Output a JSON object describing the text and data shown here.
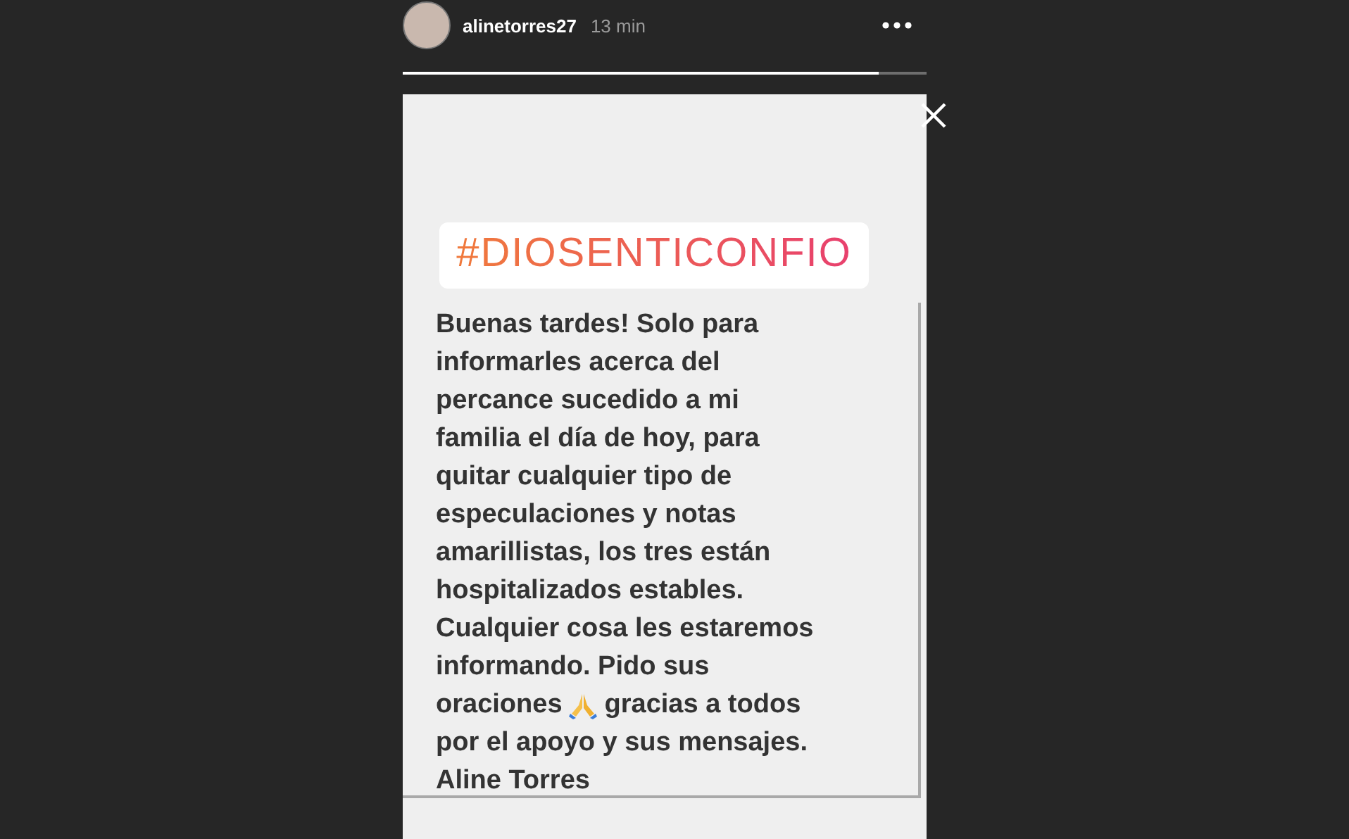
{
  "header": {
    "username": "alinetorres27",
    "time": "13 min"
  },
  "progress": {
    "level": 0.91
  },
  "story": {
    "hashtag": "#DIOSENTICONFIO",
    "lines": [
      {
        "kind": "text",
        "text": "Buenas tardes! Solo para"
      },
      {
        "kind": "text",
        "text": "informarles acerca del"
      },
      {
        "kind": "text",
        "text": "percance sucedido a mi"
      },
      {
        "kind": "text",
        "text": "familia el día de hoy, para"
      },
      {
        "kind": "text",
        "text": "quitar cualquier tipo de"
      },
      {
        "kind": "text",
        "text": "especulaciones y notas"
      },
      {
        "kind": "text",
        "text": "amarillistas, los tres están"
      },
      {
        "kind": "text",
        "text": "hospitalizados estables."
      },
      {
        "kind": "text",
        "text": "Cualquier cosa les estaremos"
      },
      {
        "kind": "text",
        "text": "informando. Pido sus"
      },
      {
        "kind": "emoji",
        "before": "oraciones",
        "after": "gracias a todos"
      },
      {
        "kind": "text",
        "text": "por el apoyo y sus mensajes."
      },
      {
        "kind": "text",
        "text": "Aline Torres"
      }
    ]
  }
}
